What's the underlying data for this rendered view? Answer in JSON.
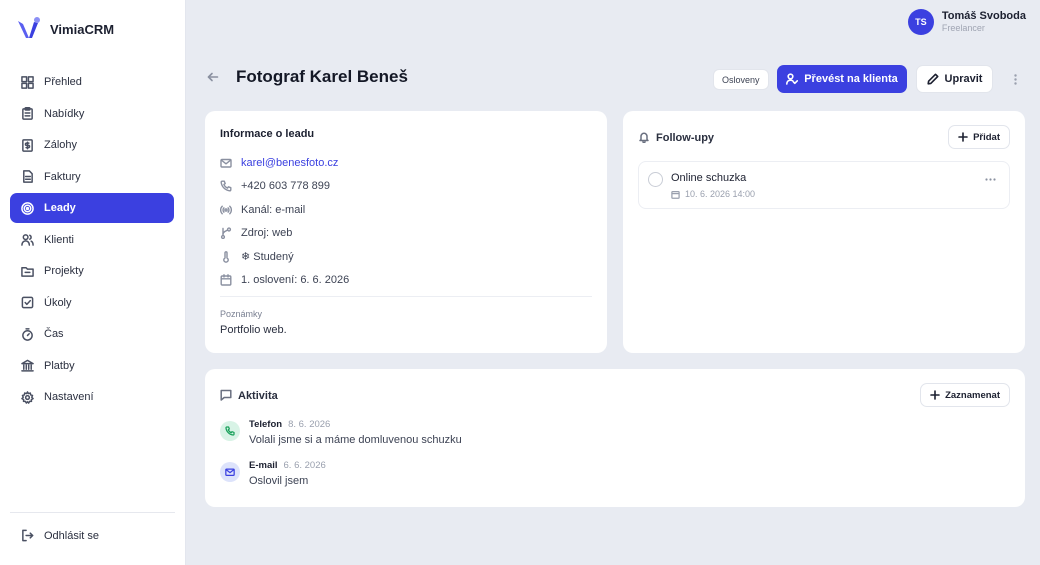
{
  "app": {
    "name": "VimiaCRM",
    "brand_color": "#3b40e0"
  },
  "user": {
    "initials": "TS",
    "name": "Tomáš Svoboda",
    "role": "Freelancer"
  },
  "sidebar": {
    "items": [
      {
        "label": "Přehled",
        "icon": "grid-icon"
      },
      {
        "label": "Nabídky",
        "icon": "clipboard-icon"
      },
      {
        "label": "Zálohy",
        "icon": "receipt-icon"
      },
      {
        "label": "Faktury",
        "icon": "file-icon"
      },
      {
        "label": "Leady",
        "icon": "target-icon",
        "active": true
      },
      {
        "label": "Klienti",
        "icon": "users-icon"
      },
      {
        "label": "Projekty",
        "icon": "folder-icon"
      },
      {
        "label": "Úkoly",
        "icon": "check-square-icon"
      },
      {
        "label": "Čas",
        "icon": "stopwatch-icon"
      },
      {
        "label": "Platby",
        "icon": "bank-icon"
      },
      {
        "label": "Nastavení",
        "icon": "gear-icon"
      }
    ],
    "logout_label": "Odhlásit se"
  },
  "header": {
    "title": "Fotograf Karel Beneš",
    "status": "Osloveny",
    "convert_label": "Převést na klienta",
    "edit_label": "Upravit"
  },
  "info": {
    "title": "Informace o leadu",
    "email": "karel@benesfoto.cz",
    "phone": "+420 603 778 899",
    "channel": "Kanál: e-mail",
    "source": "Zdroj: web",
    "temperature": "❄ Studený",
    "first_contact": "1. oslovení: 6. 6. 2026",
    "notes_label": "Poznámky",
    "notes": "Portfolio web."
  },
  "followups": {
    "title": "Follow-upy",
    "add_label": "Přidat",
    "items": [
      {
        "title": "Online schuzka",
        "date": "10. 6. 2026 14:00"
      }
    ]
  },
  "activity": {
    "title": "Aktivita",
    "record_label": "Zaznamenat",
    "items": [
      {
        "type": "Telefon",
        "date": "8. 6. 2026",
        "text": "Volali jsme si a máme domluvenou schuzku"
      },
      {
        "type": "E-mail",
        "date": "6. 6. 2026",
        "text": "Oslovil jsem"
      }
    ]
  }
}
